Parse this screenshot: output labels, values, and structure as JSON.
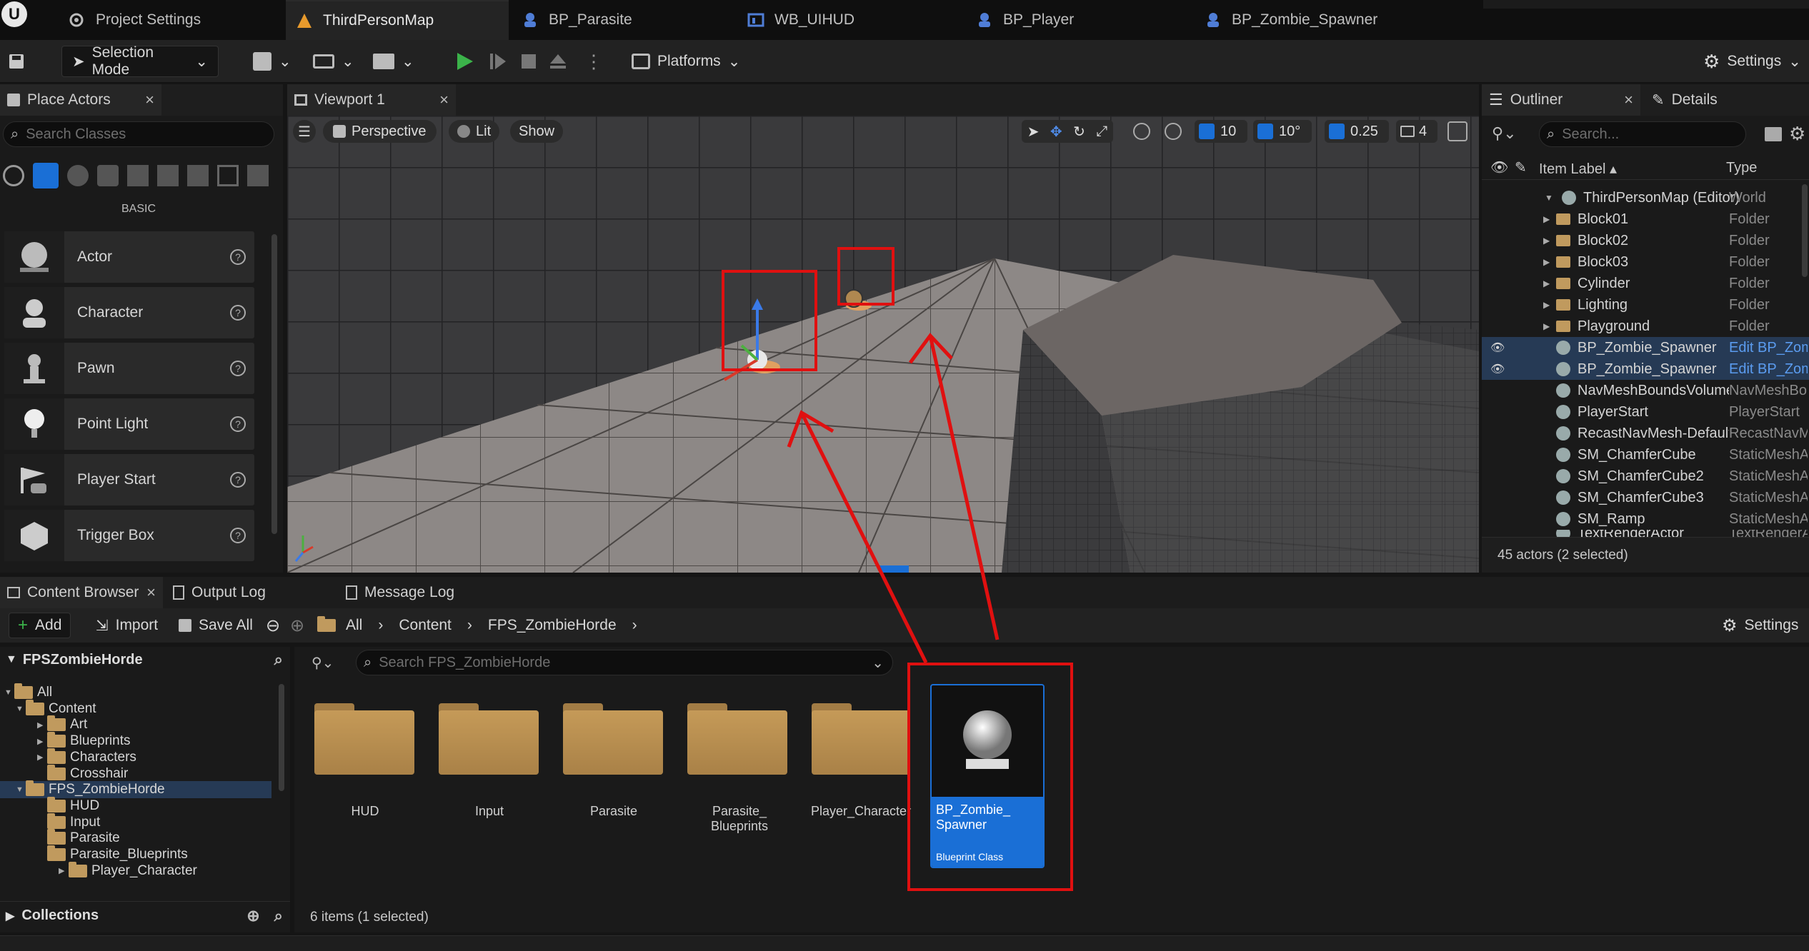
{
  "tabs": [
    {
      "label": "Project Settings",
      "icon": "settings-icon"
    },
    {
      "label": "ThirdPersonMap",
      "icon": "level-icon"
    },
    {
      "label": "BP_Parasite",
      "icon": "blueprint-icon"
    },
    {
      "label": "WB_UIHUD",
      "icon": "widget-icon"
    },
    {
      "label": "BP_Player",
      "icon": "blueprint-icon"
    },
    {
      "label": "BP_Zombie_Spawner",
      "icon": "blueprint-icon"
    }
  ],
  "toolbar": {
    "selection_mode": "Selection Mode",
    "platforms": "Platforms",
    "settings": "Settings"
  },
  "place_actors": {
    "tab": "Place Actors",
    "search_placeholder": "Search Classes",
    "section": "BASIC",
    "items": [
      {
        "label": "Actor"
      },
      {
        "label": "Character"
      },
      {
        "label": "Pawn"
      },
      {
        "label": "Point Light"
      },
      {
        "label": "Player Start"
      },
      {
        "label": "Trigger Box"
      }
    ]
  },
  "viewport": {
    "tab": "Viewport 1",
    "perspective": "Perspective",
    "lit": "Lit",
    "show": "Show",
    "grid_snap": "10",
    "rot_snap": "10°",
    "scale_snap": "0.25",
    "camera_speed": "4"
  },
  "outliner": {
    "tab": "Outliner",
    "details_tab": "Details",
    "search_placeholder": "Search...",
    "col_label": "Item Label ▴",
    "col_type": "Type",
    "rows": [
      {
        "label": "ThirdPersonMap (Editor)",
        "type": "World"
      },
      {
        "label": "Block01",
        "type": "Folder"
      },
      {
        "label": "Block02",
        "type": "Folder"
      },
      {
        "label": "Block03",
        "type": "Folder"
      },
      {
        "label": "Cylinder",
        "type": "Folder"
      },
      {
        "label": "Lighting",
        "type": "Folder"
      },
      {
        "label": "Playground",
        "type": "Folder"
      },
      {
        "label": "BP_Zombie_Spawner",
        "type": "Edit BP_Zombie_Spawner"
      },
      {
        "label": "BP_Zombie_Spawner",
        "type": "Edit BP_Zombie_Spawner"
      },
      {
        "label": "NavMeshBoundsVolume",
        "type": "NavMeshBoundsVolume"
      },
      {
        "label": "PlayerStart",
        "type": "PlayerStart"
      },
      {
        "label": "RecastNavMesh-Default",
        "type": "RecastNavMesh"
      },
      {
        "label": "SM_ChamferCube",
        "type": "StaticMeshActor"
      },
      {
        "label": "SM_ChamferCube2",
        "type": "StaticMeshActor"
      },
      {
        "label": "SM_ChamferCube3",
        "type": "StaticMeshActor"
      },
      {
        "label": "SM_Ramp",
        "type": "StaticMeshActor"
      },
      {
        "label": "TextRenderActor",
        "type": "TextRenderActor"
      }
    ],
    "status": "45 actors (2 selected)"
  },
  "bottom_tabs": {
    "content_browser": "Content Browser",
    "output_log": "Output Log",
    "message_log": "Message Log"
  },
  "content_browser": {
    "add": "Add",
    "import": "Import",
    "save_all": "Save All",
    "path": [
      "All",
      "Content",
      "FPS_ZombieHorde"
    ],
    "settings": "Settings",
    "project": "FPSZombieHorde",
    "search_placeholder": "Search FPS_ZombieHorde",
    "tree": [
      {
        "label": "All",
        "depth": 0
      },
      {
        "label": "Content",
        "depth": 1
      },
      {
        "label": "Art",
        "depth": 2
      },
      {
        "label": "Blueprints",
        "depth": 2
      },
      {
        "label": "Characters",
        "depth": 2
      },
      {
        "label": "Crosshair",
        "depth": 2
      },
      {
        "label": "FPS_ZombieHorde",
        "depth": 1
      },
      {
        "label": "HUD",
        "depth": 2
      },
      {
        "label": "Input",
        "depth": 2
      },
      {
        "label": "Parasite",
        "depth": 2
      },
      {
        "label": "Parasite_Blueprints",
        "depth": 2
      },
      {
        "label": "Player_Character",
        "depth": 1
      }
    ],
    "folders": [
      "HUD",
      "Input",
      "Parasite",
      "Parasite_\nBlueprints",
      "Player_Character"
    ],
    "asset": {
      "name": "BP_Zombie_\nSpawner",
      "type": "Blueprint Class"
    },
    "collections": "Collections",
    "status": "6 items (1 selected)"
  },
  "colors": {
    "accent": "#1a6fd6",
    "highlight": "#e01010",
    "folder": "#c09a5e"
  }
}
